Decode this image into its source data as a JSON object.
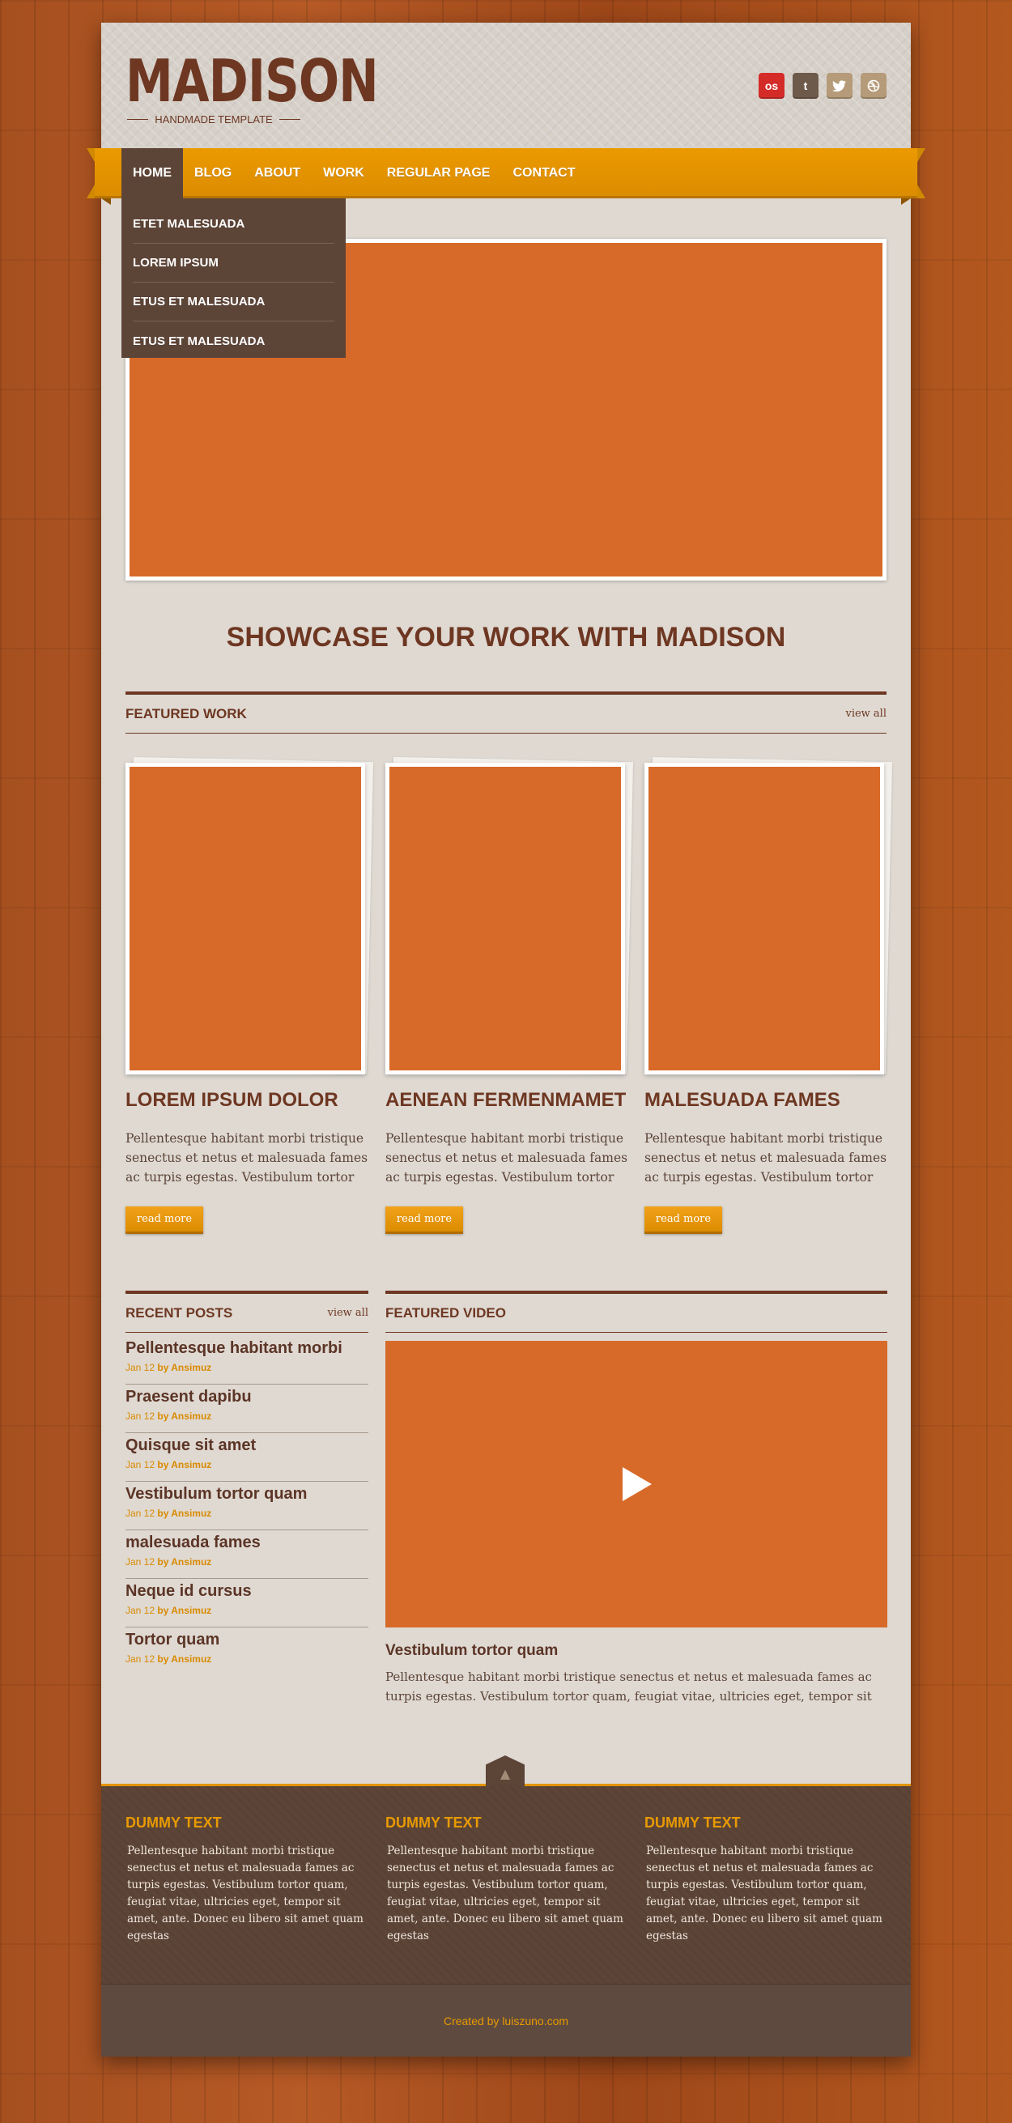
{
  "header": {
    "logo": "MADISON",
    "tagline": "HANDMADE TEMPLATE",
    "social": [
      {
        "name": "lastfm",
        "glyph": "os"
      },
      {
        "name": "tumblr",
        "glyph": "t"
      },
      {
        "name": "twitter",
        "glyph": "🐦"
      },
      {
        "name": "dribbble",
        "glyph": "◎"
      }
    ]
  },
  "nav": {
    "items": [
      "HOME",
      "BLOG",
      "ABOUT",
      "WORK",
      "REGULAR PAGE",
      "CONTACT"
    ],
    "active": "HOME",
    "dropdown": [
      "ETET MALESUADA",
      "LOREM IPSUM",
      "ETUS ET MALESUADA",
      "ETUS ET MALESUADA"
    ]
  },
  "hero": {
    "headline": "SHOWCASE YOUR WORK WITH MADISON"
  },
  "featured_work": {
    "title": "FEATURED WORK",
    "view_all": "view all",
    "items": [
      {
        "title": "LOREM IPSUM DOLOR",
        "text": "Pellentesque habitant morbi tristique senectus et netus et malesuada fames ac turpis egestas. Vestibulum tortor",
        "button": "read more"
      },
      {
        "title": "AENEAN FERMENMAMET",
        "text": "Pellentesque habitant morbi tristique senectus et netus et malesuada fames ac turpis egestas. Vestibulum tortor",
        "button": "read more"
      },
      {
        "title": "MALESUADA FAMES",
        "text": "Pellentesque habitant morbi tristique senectus et netus et malesuada fames ac turpis egestas. Vestibulum tortor",
        "button": "read more"
      }
    ]
  },
  "recent_posts": {
    "title": "RECENT POSTS",
    "view_all": "view all",
    "items": [
      {
        "title": "Pellentesque habitant morbi",
        "date": "Jan 12",
        "by": "by Ansimuz"
      },
      {
        "title": "Praesent dapibu",
        "date": "Jan 12",
        "by": "by Ansimuz"
      },
      {
        "title": "Quisque sit amet",
        "date": "Jan 12",
        "by": "by Ansimuz"
      },
      {
        "title": "Vestibulum tortor quam",
        "date": "Jan 12",
        "by": "by Ansimuz"
      },
      {
        "title": "malesuada fames",
        "date": "Jan 12",
        "by": "by Ansimuz"
      },
      {
        "title": "Neque id cursus",
        "date": "Jan 12",
        "by": "by Ansimuz"
      },
      {
        "title": "Tortor quam",
        "date": "Jan 12",
        "by": "by Ansimuz"
      }
    ]
  },
  "featured_video": {
    "title": "FEATURED VIDEO",
    "video_title": "Vestibulum tortor quam",
    "text": "Pellentesque habitant morbi tristique senectus et netus et malesuada fames ac turpis egestas. Vestibulum tortor quam, feugiat vitae, ultricies eget, tempor sit"
  },
  "footer": {
    "columns": [
      {
        "title": "DUMMY TEXT",
        "text": "Pellentesque habitant morbi tristique senectus et netus et malesuada fames ac turpis egestas. Vestibulum tortor quam, feugiat vitae, ultricies eget, tempor sit amet, ante. Donec eu libero sit amet quam egestas"
      },
      {
        "title": "DUMMY TEXT",
        "text": "Pellentesque habitant morbi tristique senectus et netus et malesuada fames ac turpis egestas. Vestibulum tortor quam, feugiat vitae, ultricies eget, tempor sit amet, ante. Donec eu libero sit amet quam egestas"
      },
      {
        "title": "DUMMY TEXT",
        "text": "Pellentesque habitant morbi tristique senectus et netus et malesuada fames ac turpis egestas. Vestibulum tortor quam, feugiat vitae, ultricies eget, tempor sit amet, ante. Donec eu libero sit amet quam egestas"
      }
    ],
    "back_to_top_icon": "arrow-up-icon",
    "copyright": "Created by luiszuno.com"
  },
  "colors": {
    "brown": "#6e3722",
    "orange_accent": "#e39400",
    "image_placeholder": "#d76a29",
    "dropdown_bg": "#5c4437"
  }
}
